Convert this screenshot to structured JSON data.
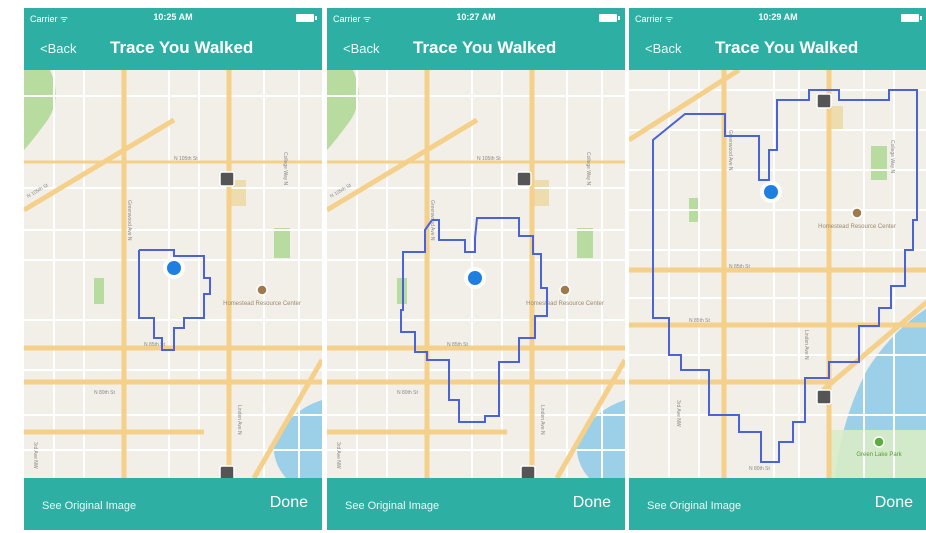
{
  "colors": {
    "accent": "#2eafa3",
    "trace": "#4a63d6",
    "location_dot": "#1f7fe0",
    "road_major": "#f4d08a",
    "park": "#b8dba0",
    "water": "#9ccfe8"
  },
  "screens": [
    {
      "status": {
        "carrier": "Carrier ᯤ",
        "time": "10:25 AM"
      },
      "nav": {
        "back_label": "<Back",
        "title": "Trace You Walked"
      },
      "bottom": {
        "see_original_label": "See Original Image",
        "done_label": "Done"
      },
      "map": {
        "street_a": "N 105th St",
        "street_b": "N 85th St",
        "street_c": "N 80th St",
        "ave_a": "Greenwood Ave N",
        "ave_b": "College Way N",
        "ave_c": "Linden Ave N",
        "ave_d": "3rd Ave NW",
        "poi": "Homestead Resource Center",
        "park": ""
      }
    },
    {
      "status": {
        "carrier": "Carrier ᯤ",
        "time": "10:27 AM"
      },
      "nav": {
        "back_label": "<Back",
        "title": "Trace You Walked"
      },
      "bottom": {
        "see_original_label": "See Original Image",
        "done_label": "Done"
      },
      "map": {
        "street_a": "N 105th St",
        "street_b": "N 85th St",
        "street_c": "N 80th St",
        "ave_a": "Greenwood Ave N",
        "ave_b": "College Way N",
        "ave_c": "Linden Ave N",
        "ave_d": "3rd Ave NW",
        "poi": "Homestead Resource Center",
        "park": ""
      }
    },
    {
      "status": {
        "carrier": "Carrier ᯤ",
        "time": "10:29 AM"
      },
      "nav": {
        "back_label": "<Back",
        "title": "Trace You Walked"
      },
      "bottom": {
        "see_original_label": "See Original Image",
        "done_label": "Done"
      },
      "map": {
        "street_a": "N 105th St",
        "street_b": "N 85th St",
        "street_c": "N 80th St",
        "ave_a": "Greenwood Ave N",
        "ave_b": "College Way N",
        "ave_c": "Linden Ave N",
        "ave_d": "3rd Ave NW",
        "poi": "Homestead Resource Center",
        "park": "Green Lake Park"
      }
    }
  ]
}
